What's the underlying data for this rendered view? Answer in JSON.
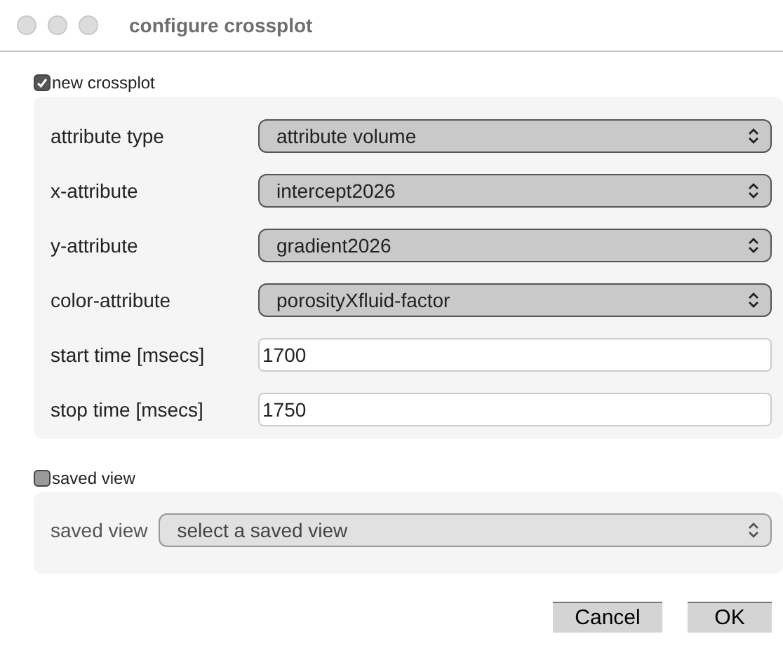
{
  "window": {
    "title": "configure crossplot"
  },
  "groups": [
    {
      "label": "new crossplot",
      "checked": true,
      "disabled": false,
      "fields": [
        {
          "label": "attribute type",
          "kind": "select",
          "value": "attribute volume"
        },
        {
          "label": "x-attribute",
          "kind": "select",
          "value": "intercept2026"
        },
        {
          "label": "y-attribute",
          "kind": "select",
          "value": "gradient2026"
        },
        {
          "label": "color-attribute",
          "kind": "select",
          "value": "porosityXfluid-factor"
        },
        {
          "label": "start time [msecs]",
          "kind": "text",
          "value": "1700"
        },
        {
          "label": "stop time [msecs]",
          "kind": "text",
          "value": "1750"
        }
      ]
    },
    {
      "label": "saved view",
      "checked": false,
      "disabled": true,
      "fields": [
        {
          "label": "saved view",
          "kind": "select",
          "value": "select a saved view"
        }
      ]
    }
  ],
  "buttons": [
    "Cancel",
    "OK"
  ]
}
